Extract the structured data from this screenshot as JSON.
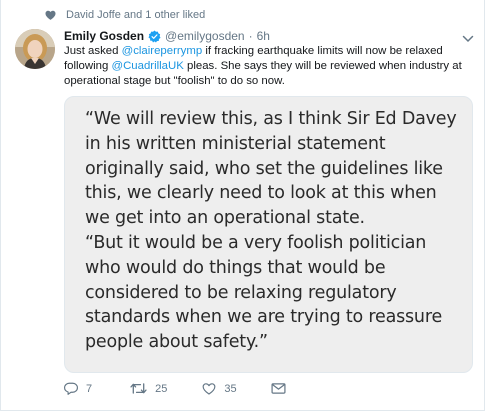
{
  "context": {
    "text": "David Joffe and 1 other liked",
    "icon": "heart-icon"
  },
  "tweet": {
    "author_name": "Emily Gosden",
    "verified": true,
    "handle": "@emilygosden",
    "separator": "·",
    "time": "6h",
    "text_parts": {
      "p1": "Just asked ",
      "m1": "@claireperrymp",
      "p2": " if fracking earthquake limits will now be relaxed following ",
      "m2": "@CuadrillaUK",
      "p3": " pleas. She says they will be reviewed when industry at operational stage but \"foolish\" to do so now."
    },
    "quote_paragraph_1": "“We will review this, as I think Sir Ed Davey in his written ministerial statement originally said, who set the guidelines like this, we clearly need to look at this when we get into an operational state.",
    "quote_paragraph_2": "“But it would be a very foolish politician who would do things that would be considered to be relaxing regulatory standards when we are trying to reassure people about safety.”"
  },
  "actions": {
    "reply_count": "7",
    "retweet_count": "25",
    "like_count": "35"
  },
  "colors": {
    "link": "#1b95e0",
    "verified": "#1da1f2",
    "muted": "#657786",
    "media_bg": "#eeeeee"
  }
}
